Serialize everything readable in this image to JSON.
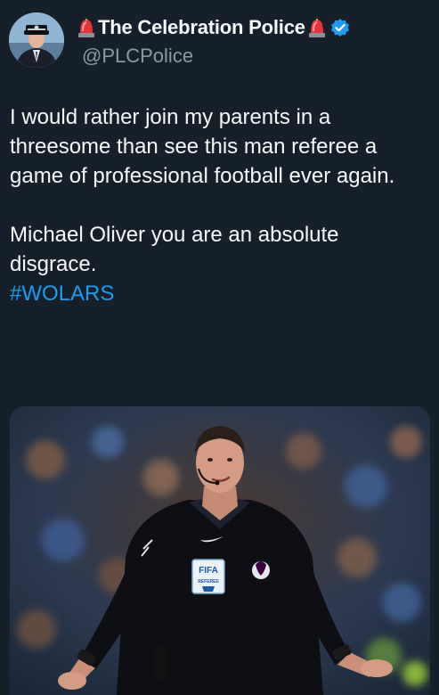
{
  "author": {
    "display_name": "The Celebration Police",
    "handle": "@PLCPolice",
    "verified": true,
    "name_emoji_left": "police-light-icon",
    "name_emoji_right": "police-light-icon"
  },
  "tweet": {
    "paragraph_1": "I would rather join my parents in a threesome than see this man referee a game of professional football ever again.",
    "paragraph_2": "Michael Oliver you are an absolute disgrace.",
    "hashtag": "#WOLARS"
  },
  "media": {
    "badge_top": "FIFA",
    "badge_sub": "REFEREE"
  },
  "colors": {
    "background": "#15202b",
    "text": "#f7f9f9",
    "secondary_text": "#8b98a5",
    "link": "#1d9bf0",
    "verified": "#1d9bf0"
  }
}
